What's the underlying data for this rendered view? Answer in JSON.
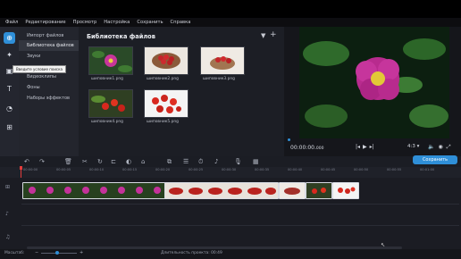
{
  "menu": [
    "Файл",
    "Редактирование",
    "Просмотр",
    "Настройка",
    "Сохранить",
    "Справка"
  ],
  "sidebar_categories": [
    {
      "label": "Импорт файлов"
    },
    {
      "label": "Библиотека файлов"
    },
    {
      "label": "Звуки"
    },
    {
      "label": "Видеоклипы"
    },
    {
      "label": "Фоны"
    },
    {
      "label": "Наборы эффектов"
    }
  ],
  "tooltip": "Введите условие поиска",
  "library": {
    "title": "Библиотека файлов",
    "items": [
      {
        "label": "шиповник1.png"
      },
      {
        "label": "шиповник2.png"
      },
      {
        "label": "шиповник3.png"
      },
      {
        "label": "шиповник4.png"
      },
      {
        "label": "шиповник5.png"
      }
    ]
  },
  "player": {
    "timecode": "00:00:00",
    "timecode_ms": "000",
    "aspect": "4:3"
  },
  "timeline": {
    "save_label": "Сохранить",
    "ticks": [
      "00:00:00",
      "00:00:05",
      "00:00:10",
      "00:00:15",
      "00:00:20",
      "00:00:25",
      "00:00:30",
      "00:00:35",
      "00:00:40",
      "00:00:45",
      "00:00:50",
      "00:00:55",
      "00:01:00"
    ]
  },
  "status": {
    "zoom_label": "Масштаб:",
    "duration_label": "Длительность проекта:",
    "duration_value": "00:49"
  },
  "colors": {
    "accent": "#2f8fd8",
    "playhead": "#e43c3c"
  }
}
